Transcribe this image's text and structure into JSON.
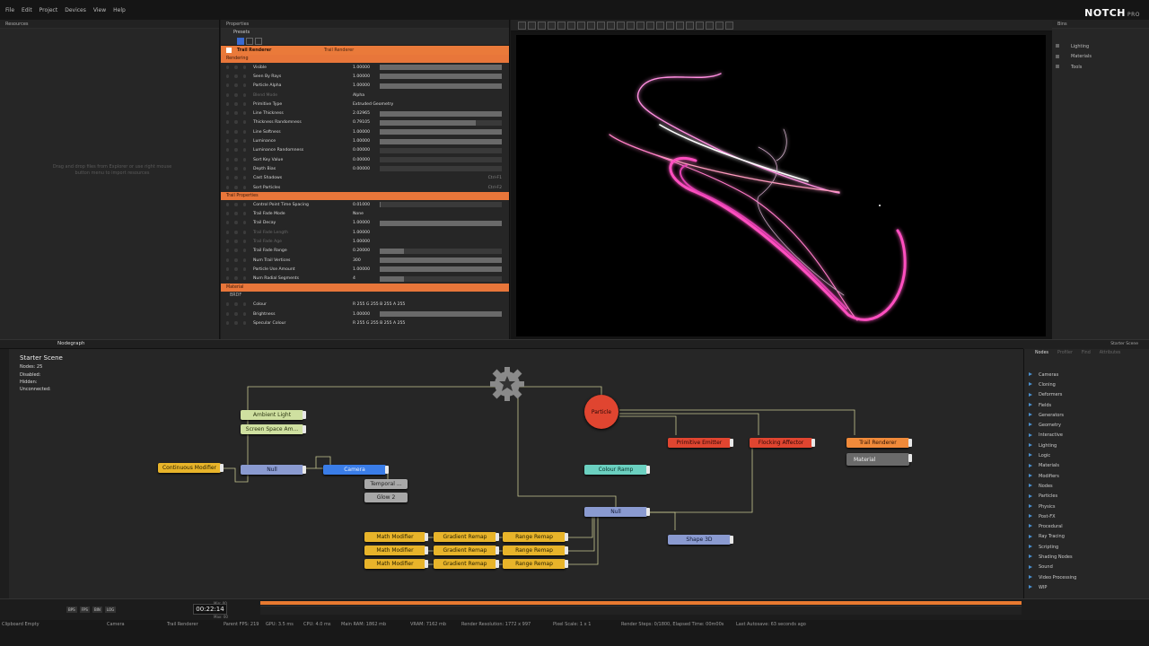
{
  "app": {
    "logo": "NOTCH",
    "edition": "PRO"
  },
  "menu": [
    "File",
    "Edit",
    "Project",
    "Devices",
    "View",
    "Help"
  ],
  "resources": {
    "title": "Resources",
    "hint": "Drag and drop files from Explorer or use right mouse button menu to import resources"
  },
  "properties": {
    "title": "Properties",
    "presets_label": "Presets",
    "node_title": "Trail Renderer",
    "node_name": "Trail Renderer",
    "sections": {
      "rendering": "Rendering",
      "trail": "Trail Properties",
      "material": "Material",
      "brdf": "BRDF"
    },
    "rendering_rows": [
      {
        "label": "Visible",
        "value": "1.00000",
        "fill": 1.0
      },
      {
        "label": "Seen By Rays",
        "value": "1.00000",
        "fill": 1.0
      },
      {
        "label": "Particle Alpha",
        "value": "1.00000",
        "fill": 1.0
      },
      {
        "label": "Blend Mode",
        "value": "Alpha",
        "dim": true
      },
      {
        "label": "Primitive Type",
        "value": "Extruded Geometry"
      },
      {
        "label": "Line Thickness",
        "value": "2.02965",
        "fill": 1.0
      },
      {
        "label": "Thickness Randomness",
        "value": "0.79105",
        "fill": 0.79
      },
      {
        "label": "Line Softness",
        "value": "1.00000",
        "fill": 1.0
      },
      {
        "label": "Luminance",
        "value": "1.00000",
        "fill": 1.0
      },
      {
        "label": "Luminance Randomness",
        "value": "0.00000",
        "fill": 0
      },
      {
        "label": "Sort Key Value",
        "value": "0.00000",
        "fill": 0
      },
      {
        "label": "Depth Bias",
        "value": "0.00000",
        "fill": 0
      },
      {
        "label": "Cast Shadows",
        "value": "",
        "shortcut": "Ctrl-F1"
      },
      {
        "label": "Sort Particles",
        "value": "",
        "shortcut": "Ctrl-F2"
      }
    ],
    "trail_rows": [
      {
        "label": "Control Point Time Spacing",
        "value": "0.01000",
        "fill": 0.01
      },
      {
        "label": "Trail Fade Mode",
        "value": "None"
      },
      {
        "label": "Trail Decay",
        "value": "1.00000",
        "fill": 1.0
      },
      {
        "label": "Trail Fade Length",
        "value": "1.00000",
        "dim": true
      },
      {
        "label": "Trail Fade Age",
        "value": "1.00000",
        "dim": true
      },
      {
        "label": "Trail Fade Range",
        "value": "0.20000",
        "fill": 0.2
      },
      {
        "label": "Num Trail Vertices",
        "value": "300",
        "fill": 1.0
      },
      {
        "label": "Particle Use Amount",
        "value": "1.00000",
        "fill": 1.0
      },
      {
        "label": "Num Radial Segments",
        "value": "4",
        "fill": 0.2
      }
    ],
    "material_rows": [
      {
        "label": "Colour",
        "value": "R 255 G 255 B 255 A 255"
      },
      {
        "label": "Brightness",
        "value": "1.00000",
        "fill": 1.0
      },
      {
        "label": "Specular Colour",
        "value": "R 255 G 255 B 255 A 255"
      }
    ]
  },
  "bins": {
    "title": "Bins",
    "items": [
      "Lighting",
      "Materials",
      "Tools"
    ]
  },
  "nodegraph": {
    "title": "Nodegraph",
    "scene_name": "Starter Scene",
    "stats": [
      "Nodes: 25",
      "Disabled:",
      "Hidden:",
      "Unconnected:"
    ],
    "nodes": {
      "ambient_light": "Ambient Light",
      "ssao": "Screen Space Am...",
      "continuous_modifier": "Continuous Modifier",
      "null_a": "Null",
      "camera": "Camera",
      "temporal": "Temporal ...",
      "glow": "Glow 2",
      "particle": "Particle",
      "primitive_emitter": "Primitive Emitter",
      "flocking_affector": "Flocking Affector",
      "trail_renderer": "Trail Renderer",
      "material": "Material",
      "colour_ramp": "Colour Ramp",
      "null_b": "Null",
      "shape3d": "Shape 3D",
      "math_modifiers": [
        "Math Modifier",
        "Math Modifier",
        "Math Modifier"
      ],
      "gradient_remaps": [
        "Gradient Remap",
        "Gradient Remap",
        "Gradient Remap"
      ],
      "range_remaps": [
        "Range Remap",
        "Range Remap",
        "Range Remap"
      ]
    }
  },
  "nodes_panel": {
    "tabs": [
      "Nodes",
      "Profiler",
      "Find",
      "Attributes"
    ],
    "items": [
      "Cameras",
      "Cloning",
      "Deformers",
      "Fields",
      "Generators",
      "Geometry",
      "Interactive",
      "Lighting",
      "Logic",
      "Materials",
      "Modifiers",
      "Nodes",
      "Particles",
      "Physics",
      "Post-FX",
      "Procedural",
      "Ray Tracing",
      "Scripting",
      "Shading Nodes",
      "Sound",
      "Video Processing",
      "WIP"
    ]
  },
  "timeline": {
    "timecode": "00:22:14",
    "min_label": "Min: 00",
    "max_label": "Max: 00",
    "buttons": [
      "BPS",
      "FPS",
      "BIN",
      "LOG"
    ]
  },
  "status": {
    "clipboard": "Clipboard Empty",
    "camera": "Camera",
    "selected": "Trail Renderer",
    "fps": "Parent FPS: 219",
    "gpu": "GPU: 3.5 ms",
    "cpu": "CPU: 4.0 ms",
    "ram": "Main RAM: 1862 mb",
    "vram": "VRAM: 7162 mb",
    "resolution": "Render Resolution: 1772 x 997",
    "pixel_scale": "Pixel Scale: 1 x 1",
    "render_steps": "Render Steps: 0/1800, Elapsed Time: 00m00s",
    "autosave": "Last Autosave: 63 seconds ago"
  },
  "viewport_label": "Starter Scene"
}
